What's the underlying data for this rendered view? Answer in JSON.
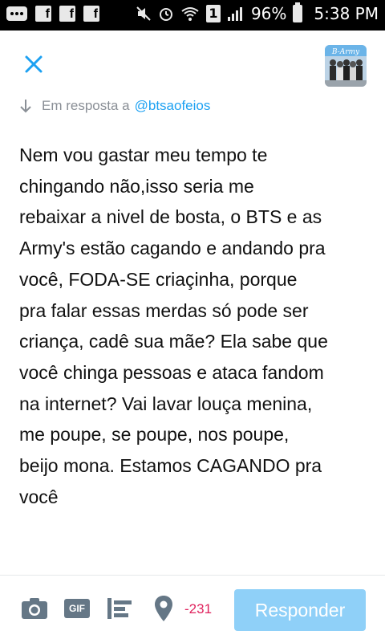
{
  "status_bar": {
    "sim_slot": "1",
    "battery": "96%",
    "time": "5:38 PM"
  },
  "header": {
    "avatar_caption": "B-Army"
  },
  "reply": {
    "prefix": "Em resposta a",
    "handle": "@btsaofeios"
  },
  "tweet": {
    "text": "Nem vou gastar meu tempo te\nchingando não,isso seria me\nrebaixar a nivel de bosta, o BTS e as\nArmy's estão cagando e andando pra\nvocê, FODA-SE criaçinha, porque\npra falar essas merdas só pode ser\ncriança, cadê sua mãe? Ela sabe que\nvocê chinga pessoas e ataca fandom\nna internet? Vai lavar louça menina,\nme poupe, se poupe, nos poupe,\nbeijo mona. Estamos CAGANDO pra\nvocê"
  },
  "toolbar": {
    "gif_label": "GIF",
    "char_counter": "-231",
    "reply_button": "Responder"
  },
  "colors": {
    "accent": "#1da1f2",
    "button_disabled": "#8fd0f8",
    "counter_negative": "#e0245e",
    "icon_gray": "#657786"
  }
}
